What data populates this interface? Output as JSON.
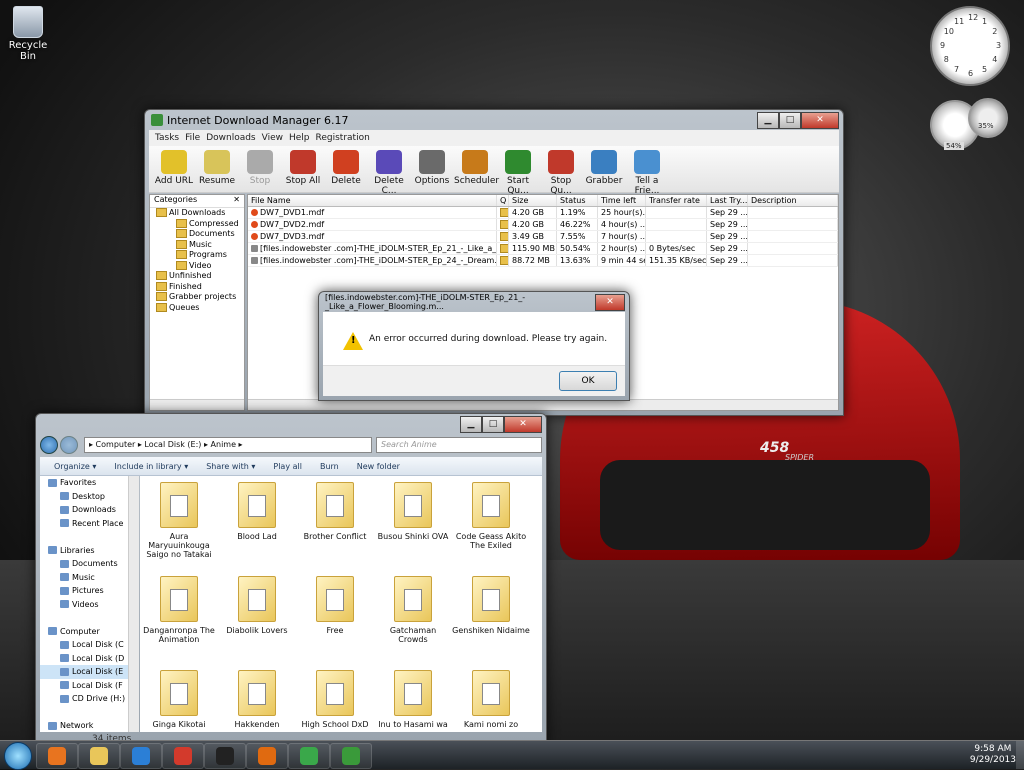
{
  "desktop": {
    "recycle_bin": "Recycle Bin",
    "car_badge": "458",
    "car_badge_sub": "SPIDER",
    "clock_numbers": [
      "12",
      "1",
      "2",
      "3",
      "4",
      "5",
      "6",
      "7",
      "8",
      "9",
      "10",
      "11"
    ],
    "cpu_gauge": "54%",
    "mem_gauge": "35%"
  },
  "idm": {
    "title": "Internet Download Manager 6.17",
    "menu": [
      "Tasks",
      "File",
      "Downloads",
      "View",
      "Help",
      "Registration"
    ],
    "toolbar": [
      "Add URL",
      "Resume",
      "Stop",
      "Stop All",
      "Delete",
      "Delete C...",
      "Options",
      "Scheduler",
      "Start Qu...",
      "Stop Qu...",
      "Grabber",
      "Tell a Frie..."
    ],
    "categories_title": "Categories",
    "categories": [
      {
        "label": "All Downloads",
        "level": 1
      },
      {
        "label": "Compressed",
        "level": 2
      },
      {
        "label": "Documents",
        "level": 2
      },
      {
        "label": "Music",
        "level": 2
      },
      {
        "label": "Programs",
        "level": 2
      },
      {
        "label": "Video",
        "level": 2
      },
      {
        "label": "Unfinished",
        "level": 1
      },
      {
        "label": "Finished",
        "level": 1
      },
      {
        "label": "Grabber projects",
        "level": 1
      },
      {
        "label": "Queues",
        "level": 1
      }
    ],
    "columns": [
      "File Name",
      "Q",
      "Size",
      "Status",
      "Time left",
      "Transfer rate",
      "Last Try...",
      "Description"
    ],
    "rows": [
      {
        "name": "DW7_DVD1.mdf",
        "size": "4.20 GB",
        "status": "1.19%",
        "time": "25 hour(s)...",
        "rate": "",
        "last": "Sep 29 ...",
        "type": "mdf"
      },
      {
        "name": "DW7_DVD2.mdf",
        "size": "4.20 GB",
        "status": "46.22%",
        "time": "4 hour(s) ...",
        "rate": "",
        "last": "Sep 29 ...",
        "type": "mdf"
      },
      {
        "name": "DW7_DVD3.mdf",
        "size": "3.49 GB",
        "status": "7.55%",
        "time": "7 hour(s) ...",
        "rate": "",
        "last": "Sep 29 ...",
        "type": "mdf"
      },
      {
        "name": "[files.indowebster .com]-THE_iDOLM-STER_Ep_21_-_Like_a_Flower_Bloo...",
        "size": "115.90 MB",
        "status": "50.54%",
        "time": "2 hour(s) ...",
        "rate": "0 Bytes/sec",
        "last": "Sep 29 ...",
        "type": "mkv"
      },
      {
        "name": "[files.indowebster .com]-THE_iDOLM-STER_Ep_24_-_Dream.mkv",
        "size": "88.72 MB",
        "status": "13.63%",
        "time": "9 min 44 sec",
        "rate": "151.35 KB/sec",
        "last": "Sep 29 ...",
        "type": "mkv"
      }
    ]
  },
  "dialog": {
    "title": "[files.indowebster.com]-THE_iDOLM-STER_Ep_21_-_Like_a_Flower_Blooming.m...",
    "message": "An error occurred during download. Please try again.",
    "ok": "OK"
  },
  "explorer": {
    "address": [
      "Computer",
      "Local Disk (E:)",
      "Anime"
    ],
    "search_placeholder": "Search Anime",
    "commands": [
      "Organize ▾",
      "Include in library ▾",
      "Share with ▾",
      "Play all",
      "Burn",
      "New folder"
    ],
    "nav": [
      {
        "label": "Favorites",
        "sub": false,
        "sel": false
      },
      {
        "label": "Desktop",
        "sub": true,
        "sel": false
      },
      {
        "label": "Downloads",
        "sub": true,
        "sel": false
      },
      {
        "label": "Recent Place",
        "sub": true,
        "sel": false
      },
      {
        "label": "",
        "sub": false,
        "sel": false
      },
      {
        "label": "Libraries",
        "sub": false,
        "sel": false
      },
      {
        "label": "Documents",
        "sub": true,
        "sel": false
      },
      {
        "label": "Music",
        "sub": true,
        "sel": false
      },
      {
        "label": "Pictures",
        "sub": true,
        "sel": false
      },
      {
        "label": "Videos",
        "sub": true,
        "sel": false
      },
      {
        "label": "",
        "sub": false,
        "sel": false
      },
      {
        "label": "Computer",
        "sub": false,
        "sel": false
      },
      {
        "label": "Local Disk (C",
        "sub": true,
        "sel": false
      },
      {
        "label": "Local Disk (D",
        "sub": true,
        "sel": false
      },
      {
        "label": "Local Disk (E",
        "sub": true,
        "sel": true
      },
      {
        "label": "Local Disk (F",
        "sub": true,
        "sel": false
      },
      {
        "label": "CD Drive (H:)",
        "sub": true,
        "sel": false
      },
      {
        "label": "",
        "sub": false,
        "sel": false
      },
      {
        "label": "Network",
        "sub": false,
        "sel": false
      }
    ],
    "folders": [
      "Aura Maryuuinkouga Saigo no Tatakai",
      "Blood Lad",
      "Brother Conflict",
      "Busou Shinki OVA",
      "Code Geass Akito The Exiled",
      "Danganronpa The Animation",
      "Diabolik Lovers",
      "Free",
      "Gatchaman Crowds",
      "Genshiken Nidaime",
      "Ginga Kikotai",
      "Hakkenden",
      "High School DxD",
      "Inu to Hasami wa",
      "Kami nomi zo"
    ],
    "status": "34 items"
  },
  "taskbar": {
    "time": "9:58 AM",
    "date": "9/29/2013",
    "apps": [
      {
        "name": "media-player",
        "color": "#e8741f"
      },
      {
        "name": "file-explorer",
        "color": "#e9c65a"
      },
      {
        "name": "internet-explorer",
        "color": "#2b7fd6"
      },
      {
        "name": "chrome",
        "color": "#d33a2c"
      },
      {
        "name": "blackberry",
        "color": "#222"
      },
      {
        "name": "firefox",
        "color": "#e06a10"
      },
      {
        "name": "idm-download",
        "color": "#3aa84a"
      },
      {
        "name": "media-classic",
        "color": "#3a9a3a"
      }
    ]
  }
}
